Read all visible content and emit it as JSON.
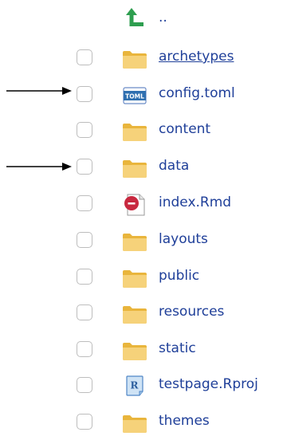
{
  "parent": {
    "label": "..",
    "icon": "up-arrow-icon"
  },
  "files": [
    {
      "name": "archetypes",
      "icon": "folder-icon",
      "hovered": true
    },
    {
      "name": "config.toml",
      "icon": "toml-file-icon"
    },
    {
      "name": "content",
      "icon": "folder-icon"
    },
    {
      "name": "data",
      "icon": "folder-icon"
    },
    {
      "name": "index.Rmd",
      "icon": "rmd-file-icon"
    },
    {
      "name": "layouts",
      "icon": "folder-icon"
    },
    {
      "name": "public",
      "icon": "folder-icon"
    },
    {
      "name": "resources",
      "icon": "folder-icon"
    },
    {
      "name": "static",
      "icon": "folder-icon"
    },
    {
      "name": "testpage.Rproj",
      "icon": "rproj-file-icon"
    },
    {
      "name": "themes",
      "icon": "folder-icon"
    }
  ],
  "icon_labels": {
    "toml": "TOML",
    "rproj": "R"
  },
  "annotations": {
    "arrows_point_to": [
      "config.toml",
      "data"
    ]
  },
  "colors": {
    "link": "#1f3f99",
    "folder": "#f2c94c",
    "up_arrow": "#2e9e4f",
    "arrow": "#000000"
  }
}
